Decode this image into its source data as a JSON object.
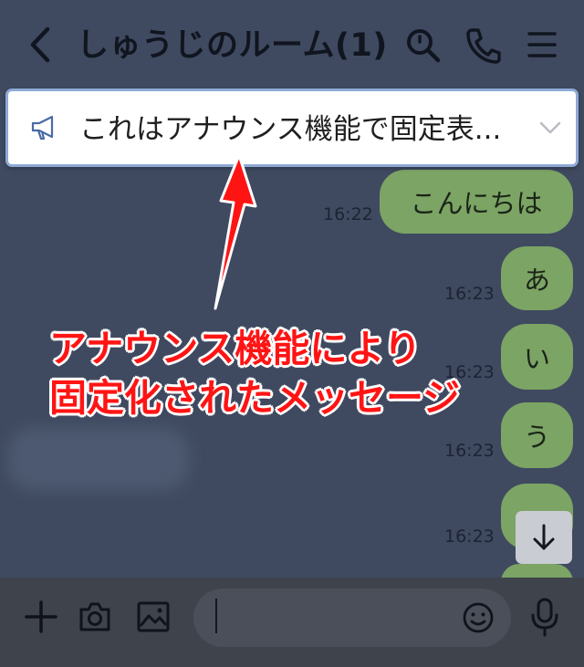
{
  "header": {
    "title": "しゅうじのルーム(1)"
  },
  "announcement": {
    "text": "これはアナウンス機能で固定表..."
  },
  "messages": [
    {
      "text": "こんにちは",
      "time": "16:22"
    },
    {
      "text": "あ",
      "time": "16:23"
    },
    {
      "text": "い",
      "time": "16:23"
    },
    {
      "text": "う",
      "time": "16:23"
    },
    {
      "text": "",
      "time": "16:23"
    }
  ],
  "annotation": {
    "line1": "アナウンス機能により",
    "line2": "固定化されたメッセージ"
  },
  "colors": {
    "background": "#3f4a60",
    "bubble": "#7ca465",
    "annotation": "#ff1414"
  },
  "icons": [
    "back-icon",
    "search-icon",
    "phone-icon",
    "menu-icon",
    "megaphone-icon",
    "chevron-down-icon",
    "arrow-down-icon",
    "plus-icon",
    "camera-icon",
    "image-icon",
    "emoji-icon",
    "mic-icon"
  ]
}
